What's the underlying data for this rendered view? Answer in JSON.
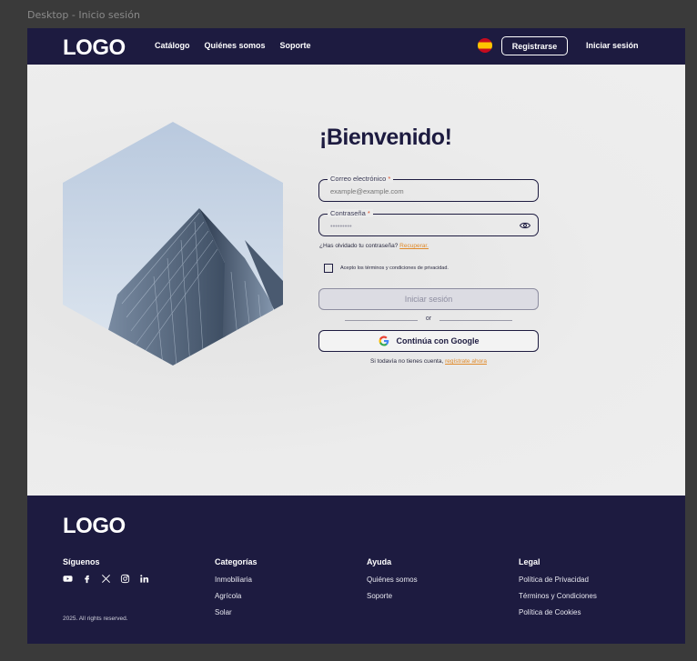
{
  "frame_label": "Desktop - Inicio sesión",
  "header": {
    "logo": "LOGO",
    "nav": [
      "Catálogo",
      "Quiénes somos",
      "Soporte"
    ],
    "register": "Registrarse",
    "login": "Iniciar sesión"
  },
  "main": {
    "title": "¡Bienvenido!",
    "email": {
      "label": "Correo electrónico",
      "required_mark": "*",
      "placeholder": "example@example.com"
    },
    "password": {
      "label": "Contraseña",
      "required_mark": "*",
      "value": "•••••••••"
    },
    "forgot_text": "¿Has olvidado tu contraseña?",
    "forgot_link": "Recuperar.",
    "terms_label": "Acepto los términos y condiciones de privacidad.",
    "submit": "Iniciar sesión",
    "or": "or",
    "google": "Continúa con Google",
    "signup_text": "Si todavía no tienes cuenta,",
    "signup_link": "regístrate ahora"
  },
  "footer": {
    "logo": "LOGO",
    "social_title": "Síguenos",
    "social_icons": [
      "youtube-icon",
      "facebook-icon",
      "x-icon",
      "instagram-icon",
      "linkedin-icon"
    ],
    "copyright": "2025. All rights reserved.",
    "categories": {
      "title": "Categorías",
      "links": [
        "Inmobiliaria",
        "Agrícola",
        "Solar"
      ]
    },
    "help": {
      "title": "Ayuda",
      "links": [
        "Quiénes somos",
        "Soporte"
      ]
    },
    "legal": {
      "title": "Legal",
      "links": [
        "Política de Privacidad",
        "Términos y Condiciones",
        "Política de Cookies"
      ]
    }
  },
  "colors": {
    "brand": "#1d1b40",
    "accent_link": "#e08a2a",
    "background": "#ececec"
  }
}
